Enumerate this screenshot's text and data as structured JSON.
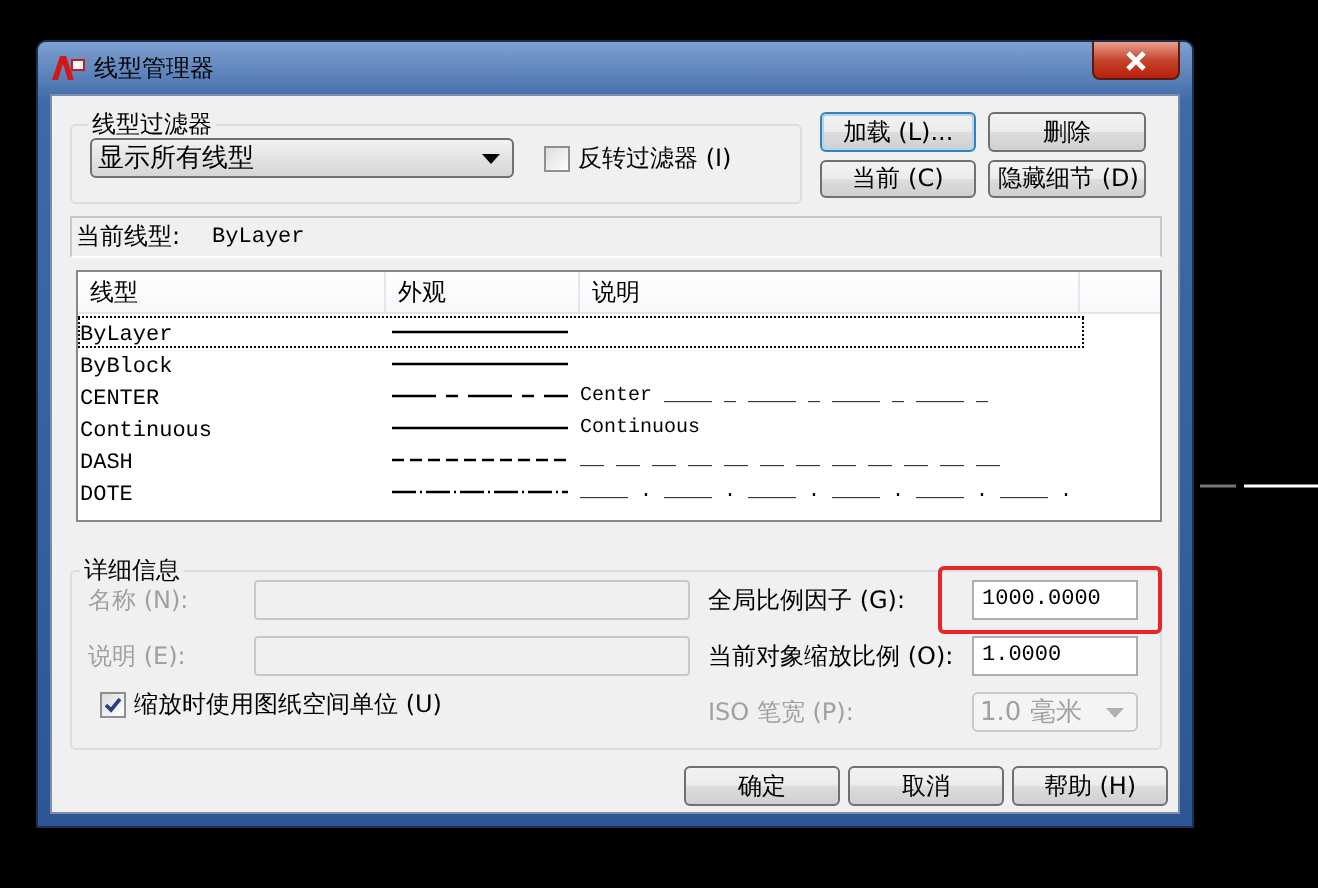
{
  "window": {
    "title": "线型管理器"
  },
  "filter": {
    "legend": "线型过滤器",
    "value": "显示所有线型",
    "invert": {
      "label": "反转过滤器 (I)",
      "checked": false
    }
  },
  "buttons": [
    {
      "label": "加载 (L)...",
      "focused": true
    },
    {
      "label": "删除",
      "focused": false
    },
    {
      "label": "当前 (C)",
      "focused": false
    },
    {
      "label": "隐藏细节 (D)",
      "focused": false
    }
  ],
  "current": {
    "label": "当前线型:",
    "value": "ByLayer"
  },
  "table": {
    "columns": [
      "线型",
      "外观",
      "说明"
    ],
    "rows": [
      {
        "name": "ByLayer",
        "kind": "solid",
        "selected": true
      },
      {
        "name": "ByBlock",
        "kind": "solid",
        "selected": false
      },
      {
        "name": "CENTER",
        "kind": "center",
        "description": "Center ____ _ ____ _ ____ _ ____ _",
        "selected": false
      },
      {
        "name": "Continuous",
        "kind": "solid",
        "description": "Continuous",
        "selected": false
      },
      {
        "name": "DASH",
        "kind": "dash",
        "description": "__ __ __ __ __ __ __ __ __ __ __ __",
        "selected": false
      },
      {
        "name": "DOTE",
        "kind": "dashdot",
        "description": "____ . ____ . ____ . ____ . ____ . ____ .",
        "selected": false
      }
    ]
  },
  "details": {
    "legend": "详细信息",
    "fields": [
      {
        "label": "名称 (N):",
        "disabled": true
      },
      {
        "label": "说明 (E):",
        "disabled": true
      }
    ],
    "paper_space": {
      "label": "缩放时使用图纸空间单位 (U)",
      "checked": true
    },
    "global_scale": {
      "label": "全局比例因子 (G):",
      "value": "1000.0000",
      "highlighted": true
    },
    "object_scale": {
      "label": "当前对象缩放比例 (O):",
      "value": "1.0000"
    },
    "pen_width": {
      "label": "ISO 笔宽 (P):",
      "value": "1.0 毫米",
      "disabled": true
    }
  },
  "footer_buttons": [
    "确定",
    "取消",
    "帮助 (H)"
  ]
}
